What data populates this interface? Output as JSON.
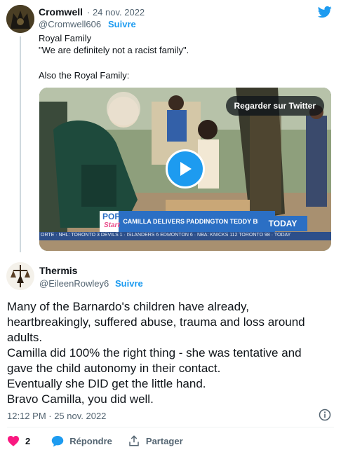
{
  "quoted": {
    "author_name": "Cromwell",
    "date": "· 24 nov. 2022",
    "handle": "@Cromwell606",
    "follow_label": "Suivre",
    "text_lines": [
      "Royal Family",
      "\"We are definitely not a racist family\".",
      "",
      "Also the Royal Family:"
    ],
    "video": {
      "watch_button": "Regarder sur Twitter",
      "banner_pop": "POP",
      "banner_star": "Start",
      "banner_caption": "CAMILLA DELIVERS PADDINGTON TEDDY BEARS",
      "network_logo": "TODAY",
      "ticker": "ORTE · NHL: TORONTO 3  DEVILS 1 · ISLANDERS 6  EDMONTON 6 · NBA: KNICKS 112  TORONTO 98 · TODAY"
    }
  },
  "reply": {
    "author_name": "Thermis",
    "handle": "@EileenRowley6",
    "follow_label": "Suivre",
    "text_lines": [
      "Many of the Barnardo's children have already,",
      "heartbreakingly, suffered abuse, trauma and loss around",
      "adults.",
      "Camilla did 100% the right thing - she was tentative and",
      "gave the child autonomy in their contact.",
      "Eventually she DID get the little hand.",
      "Bravo Camilla, you did well."
    ],
    "timestamp": "12:12 PM · 25 nov. 2022"
  },
  "actions": {
    "likes_count": "2",
    "reply_label": "Répondre",
    "share_label": "Partager"
  },
  "icons": {
    "brand": "twitter-bird-icon",
    "play": "play-icon",
    "info": "info-icon",
    "like": "heart-icon",
    "reply": "speech-bubble-icon",
    "share": "share-icon"
  },
  "colors": {
    "accent": "#1d9bf0",
    "like": "#f91880",
    "text": "#0f1419",
    "muted": "#536471"
  }
}
